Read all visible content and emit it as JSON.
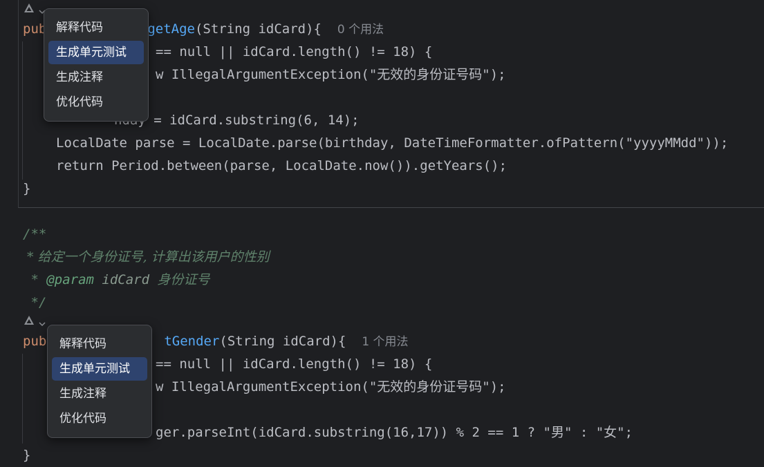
{
  "method1": {
    "header_pre": "pub",
    "method_name_part": "getAge",
    "params": "(String idCard){",
    "usage": "0 个用法",
    "line_if_part": "== null || idCard.length() != 18) {",
    "line_throw_part": "w IllegalArgumentException(\"无效的身份证号码\");",
    "line_birthday_part": "nday = idCard.substring(6, 14);",
    "line_parse": "LocalDate parse = LocalDate.parse(birthday, DateTimeFormatter.ofPattern(\"yyyyMMdd\"));",
    "line_return": "return Period.between(parse, LocalDate.now()).getYears();",
    "close": "}"
  },
  "doc": {
    "open": "/**",
    "desc": " * 给定一个身份证号, 计算出该用户的性别",
    "param_star": " * ",
    "param_tag": "@param",
    "param_name": " idCard",
    "param_desc": " 身份证号",
    "close": " */"
  },
  "method2": {
    "header_pre": "pub",
    "method_name_part": "tGender",
    "params": "(String idCard){",
    "usage": "1 个用法",
    "line_if_part": "== null || idCard.length() != 18) {",
    "line_throw_part": "w IllegalArgumentException(\"无效的身份证号码\");",
    "line_return_part": "ger.parseInt(idCard.substring(16,17)) % 2 == 1 ? \"男\" : \"女\";",
    "close": "}"
  },
  "menu": {
    "items": [
      "解释代码",
      "生成单元测试",
      "生成注释",
      "优化代码"
    ],
    "active_index": 1
  },
  "icons": {
    "ai_icon": "ai-assistant-icon",
    "chevron": "chevron-down-icon"
  },
  "colors": {
    "keyword": "#cf8e6d",
    "method": "#56a8f5",
    "number": "#2aacb8",
    "string": "#6aab73",
    "comment": "#5f826b",
    "menu_highlight": "#2e436e"
  }
}
